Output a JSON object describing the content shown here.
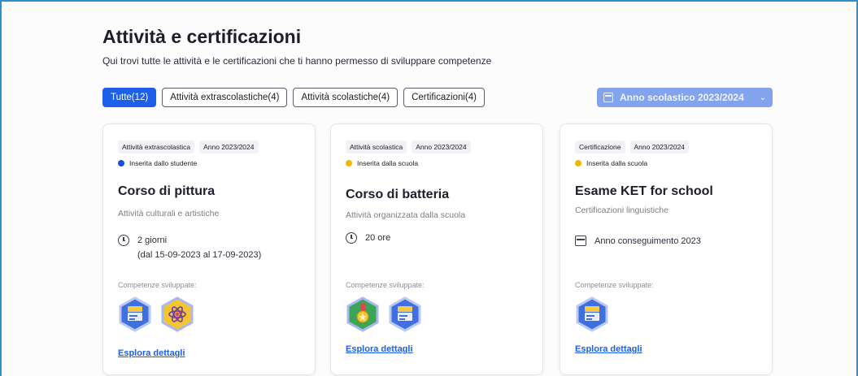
{
  "header": {
    "title": "Attività e certificazioni",
    "subtitle": "Qui trovi tutte le attività e le certificazioni che ti hanno permesso di sviluppare competenze"
  },
  "filters": [
    {
      "label": "Tutte(12)",
      "active": true
    },
    {
      "label": "Attività extrascolastiche(4)",
      "active": false
    },
    {
      "label": "Attività scolastiche(4)",
      "active": false
    },
    {
      "label": "Certificazioni(4)",
      "active": false
    }
  ],
  "year_select": {
    "value": "Anno scolastico 2023/2024",
    "icon": "calendar-icon"
  },
  "colors": {
    "accent": "#1c5fe8",
    "student_dot": "#1c4fd8",
    "school_dot": "#f2b705"
  },
  "cards": [
    {
      "type_tag": "Attività extrascolastica",
      "year_tag": "Anno 2023/2024",
      "source": "Inserita dallo studente",
      "title": "Corso di pittura",
      "category": "Attività culturali e artistiche",
      "meta_line1": "2 giorni",
      "meta_line2": "(dal 15-09-2023 al 17-09-2023)",
      "competences_label": "Competenze sviluppate:",
      "badges": [
        "language-badge",
        "science-badge"
      ],
      "link": "Esplora dettagli"
    },
    {
      "type_tag": "Attività scolastica",
      "year_tag": "Anno 2023/2024",
      "source": "Inserita dalla scuola",
      "title": "Corso di batteria",
      "category": "Attività organizzata dalla scuola",
      "meta_line1": "20 ore",
      "competences_label": "Competenze sviluppate:",
      "badges": [
        "citizenship-badge",
        "language-badge"
      ],
      "link": "Esplora dettagli"
    },
    {
      "type_tag": "Certificazione",
      "year_tag": "Anno 2023/2024",
      "source": "Inserita dalla scuola",
      "title": "Esame KET for school",
      "category": "Certificazioni linguistiche",
      "meta_line1": "Anno conseguimento 2023",
      "competences_label": "Competenze sviluppate:",
      "badges": [
        "language-badge"
      ],
      "link": "Esplora dettagli"
    }
  ]
}
